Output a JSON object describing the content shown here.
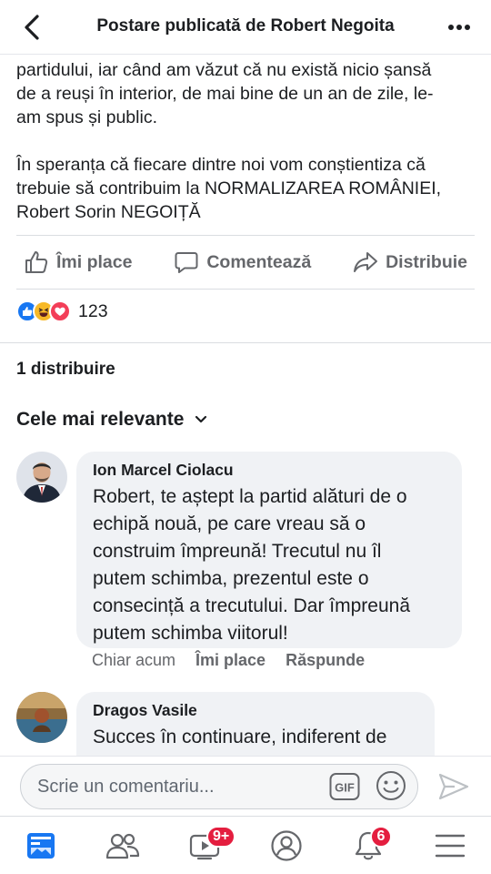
{
  "header": {
    "title": "Postare publicată de Robert Negoita",
    "back_icon": "chevron-left-icon",
    "more_icon": "more-horizontal-icon"
  },
  "post": {
    "paragraph1_lines": [
      "partidului, iar când am văzut că nu există nicio șansă",
      "de a reuși în interior, de mai bine de un an de zile, le-",
      "am spus și public."
    ],
    "paragraph2_lines": [
      "În speranța că fiecare dintre noi vom conștientiza că",
      "trebuie să contribuim la NORMALIZAREA ROMÂNIEI,",
      "Robert Sorin NEGOIȚĂ"
    ]
  },
  "actions": {
    "like_label": "Îmi place",
    "comment_label": "Comentează",
    "share_label": "Distribuie"
  },
  "reactions": {
    "types": [
      "like",
      "haha",
      "love"
    ],
    "colors": {
      "like": "#1877f2",
      "haha": "#f7b928",
      "love": "#f33e58"
    },
    "count": "123"
  },
  "shares": {
    "label": "1 distribuire"
  },
  "comments_sort": {
    "label": "Cele mai relevante"
  },
  "comments": [
    {
      "author": "Ion Marcel Ciolacu",
      "text_lines": [
        "Robert, te aștept la partid alături de o",
        "echipă nouă, pe care vreau să o",
        "construim împreună! Trecutul nu îl",
        "putem schimba, prezentul este o",
        "consecință a trecutului. Dar împreună",
        "putem schimba viitorul!"
      ],
      "time": "Chiar acum",
      "like_label": "Îmi place",
      "reply_label": "Răspunde"
    },
    {
      "author": "Dragos Vasile",
      "text_lines": [
        "Succes în continuare, indiferent de"
      ]
    }
  ],
  "composer": {
    "placeholder": "Scrie un comentariu...",
    "gif_label": "GIF"
  },
  "tabbar": {
    "items": [
      {
        "name": "news-feed",
        "badge": ""
      },
      {
        "name": "friends",
        "badge": ""
      },
      {
        "name": "watch",
        "badge": "9+"
      },
      {
        "name": "profile",
        "badge": ""
      },
      {
        "name": "notifications",
        "badge": "6"
      },
      {
        "name": "menu",
        "badge": ""
      }
    ]
  }
}
